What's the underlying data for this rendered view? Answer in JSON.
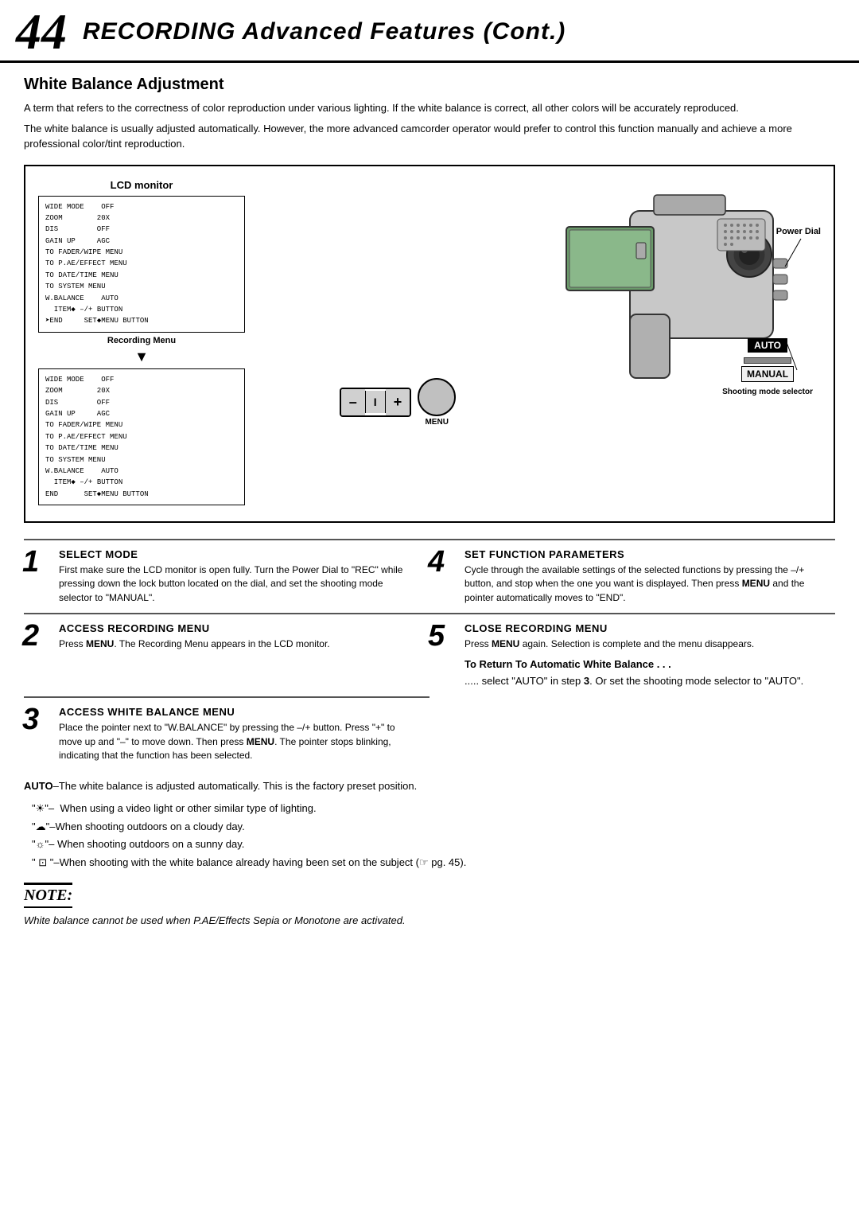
{
  "header": {
    "page_number": "44",
    "title": "RECORDING Advanced Features (Cont.)"
  },
  "section": {
    "title": "White Balance Adjustment",
    "intro1": "A term that refers to the correctness of color reproduction under various lighting. If the white balance is correct, all other colors will be accurately reproduced.",
    "intro2": "The white balance is usually adjusted automatically. However, the more advanced camcorder operator would prefer to control this function manually and achieve a more professional color/tint reproduction."
  },
  "diagram": {
    "lcd_label": "LCD monitor",
    "power_dial_label": "Power Dial",
    "shooting_mode_label": "Shooting mode selector",
    "menu_label": "MENU",
    "auto_selector": "AUTO",
    "manual_selector": "MANUAL",
    "recording_menu_label": "Recording Menu",
    "menu_box1": [
      "WIDE MODE    OFF",
      "ZOOM         20X",
      "DIS          OFF",
      "GAIN UP      AGC",
      "TO FADER/WIPE MENU",
      "TO P.AE/EFFECT MENU",
      "TO DATE/TIME MENU",
      "TO SYSTEM MENU",
      "W.BALANCE    AUTO",
      "  ITEM◆ –/+ BUTTON",
      "➤END    SET◆MENU BUTTON"
    ],
    "menu_box2": [
      "WIDE MODE    OFF",
      "ZOOM         20X",
      "DIS          OFF",
      "GAIN UP      AGC",
      "TO FADER/WIPE MENU",
      "TO P.AE/EFFECT MENU",
      "TO DATE/TIME MENU",
      "TO SYSTEM MENU",
      "W.BALANCE    AUTO",
      "  ITEM◆ –/+ BUTTON",
      "END    SET◆MENU BUTTON"
    ],
    "controls": {
      "minus": "–",
      "divider": "I",
      "plus": "+"
    }
  },
  "steps": [
    {
      "number": "1",
      "heading": "SELECT MODE",
      "body": "First make sure the LCD monitor is open fully. Turn the Power Dial to \"REC\" while pressing down the lock button located on the dial, and set the shooting mode selector to \"MANUAL\"."
    },
    {
      "number": "4",
      "heading": "SET FUNCTION PARAMETERS",
      "body": "Cycle through the available settings of the selected functions by pressing the –/+ button, and stop when the one you want is displayed. Then press MENU and the pointer automatically moves to \"END\"."
    },
    {
      "number": "2",
      "heading": "ACCESS RECORDING MENU",
      "body": "Press MENU. The Recording Menu appears in the LCD monitor."
    },
    {
      "number": "5",
      "heading": "CLOSE RECORDING MENU",
      "body": "Press MENU again. Selection is complete and the menu disappears."
    },
    {
      "number": "3",
      "heading": "ACCESS WHITE BALANCE MENU",
      "body": "Place the pointer next to \"W.BALANCE\" by pressing the –/+ button. Press \"+\" to move up and \"–\" to move down. Then press MENU. The pointer stops blinking, indicating that the function has been selected."
    }
  ],
  "return_section": {
    "title": "To Return To Automatic White Balance . . .",
    "body": "..... select \"AUTO\" in step 3. Or set the shooting mode selector to \"AUTO\"."
  },
  "bottom_info": {
    "auto_note": "AUTO–The white balance is adjusted automatically. This is the factory preset position.",
    "bullets": [
      "\"☀\"–  When using a video light or other similar type of lighting.",
      "\"☁\"–When shooting outdoors on a cloudy day.",
      "\"☼\"– When shooting outdoors on a sunny day.",
      "\" ⊡ \"–When shooting with the white balance already having been set on the subject (☞ pg. 45)."
    ]
  },
  "note": {
    "title": "NOTE:",
    "body": "White balance cannot be used when P.AE/Effects Sepia or Monotone are activated."
  }
}
